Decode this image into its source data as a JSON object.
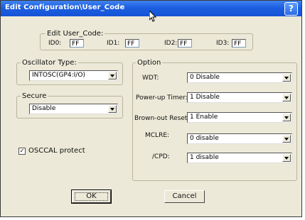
{
  "window": {
    "title": "Edit Configuration\\User_Code",
    "help": "?"
  },
  "user_code": {
    "legend": "Edit User_Code:",
    "ids": [
      {
        "label": "ID0:",
        "value": "FF"
      },
      {
        "label": "ID1:",
        "value": "FF"
      },
      {
        "label": "ID2:",
        "value": "FF"
      },
      {
        "label": "ID3:",
        "value": "FF"
      }
    ]
  },
  "oscillator": {
    "legend": "Oscillator Type:",
    "value": "INTOSC(GP4:I/O)"
  },
  "secure": {
    "legend": "Secure",
    "value": "Disable"
  },
  "osccal": {
    "label": "OSCCAL protect",
    "checked": true,
    "mark": "✓"
  },
  "option": {
    "legend": "Option",
    "rows": [
      {
        "label": "WDT:",
        "value": "0  Disable"
      },
      {
        "label": "Power-up Timer:",
        "value": "1  Disable"
      },
      {
        "label": "Brown-out Reset:",
        "value": "1  Enable"
      },
      {
        "label": "MCLRE:",
        "value": "0  disable"
      },
      {
        "label": "/CPD:",
        "value": "1  disable"
      }
    ]
  },
  "buttons": {
    "ok": "OK",
    "cancel": "Cancel"
  }
}
